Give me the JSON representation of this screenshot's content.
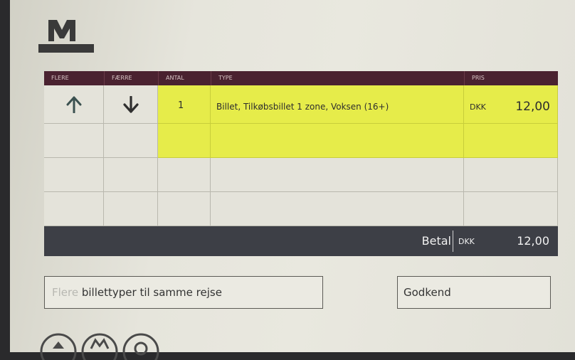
{
  "headers": {
    "flere": "FLERE",
    "faerre": "FÆRRE",
    "antal": "ANTAL",
    "type": "TYPE",
    "pris": "PRIS"
  },
  "row": {
    "antal": "1",
    "type": "Billet, Tilkøbsbillet 1 zone, Voksen (16+)",
    "currency": "DKK",
    "price": "12,00"
  },
  "total": {
    "label": "Betal",
    "currency": "DKK",
    "amount": "12,00"
  },
  "buttons": {
    "more_types_dim": "Flere",
    "more_types_rest": " billettyper til samme rejse",
    "approve": "Godkend"
  },
  "colors": {
    "header": "#4a2230",
    "highlight": "#e6ec4a",
    "total_bar": "#3d3f46",
    "arrow": "#3b3b3b"
  }
}
